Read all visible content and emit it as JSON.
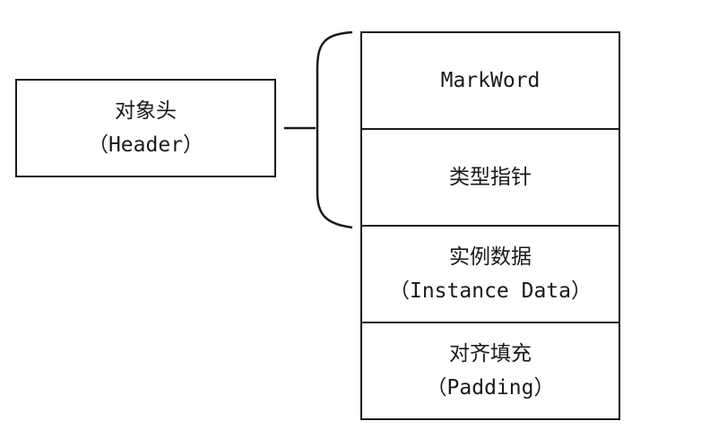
{
  "header_box": {
    "line1": "对象头",
    "line2": "（Header）"
  },
  "stack": {
    "markword": "MarkWord",
    "type_pointer": "类型指针",
    "instance_data": {
      "line1": "实例数据",
      "line2": "（Instance Data）"
    },
    "padding": {
      "line1": "对齐填充",
      "line2": "（Padding）"
    }
  },
  "colors": {
    "stroke": "#1a1a1a",
    "background": "#ffffff"
  }
}
